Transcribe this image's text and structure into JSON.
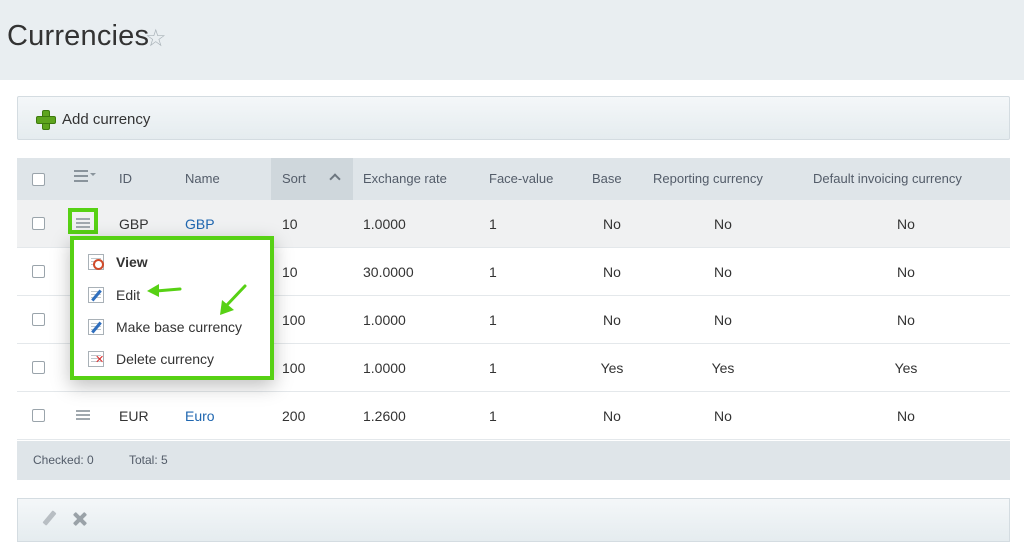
{
  "page": {
    "title": "Currencies",
    "star": "☆"
  },
  "toolbar": {
    "add_label": "Add currency"
  },
  "grid": {
    "columns": {
      "id": "ID",
      "name": "Name",
      "sort": "Sort",
      "exchange_rate": "Exchange rate",
      "face_value": "Face-value",
      "base": "Base",
      "reporting": "Reporting currency",
      "default_invoicing": "Default invoicing currency"
    },
    "rows": [
      {
        "id": "GBP",
        "name": "GBP",
        "sort": "10",
        "rate": "1.0000",
        "face": "1",
        "base": "No",
        "reporting": "No",
        "invoicing": "No"
      },
      {
        "id": "",
        "name": "",
        "sort": "10",
        "rate": "30.0000",
        "face": "1",
        "base": "No",
        "reporting": "No",
        "invoicing": "No"
      },
      {
        "id": "",
        "name": "",
        "sort": "100",
        "rate": "1.0000",
        "face": "1",
        "base": "No",
        "reporting": "No",
        "invoicing": "No"
      },
      {
        "id": "",
        "name": "",
        "sort": "100",
        "rate": "1.0000",
        "face": "1",
        "base": "Yes",
        "reporting": "Yes",
        "invoicing": "Yes"
      },
      {
        "id": "EUR",
        "name": "Euro",
        "sort": "200",
        "rate": "1.2600",
        "face": "1",
        "base": "No",
        "reporting": "No",
        "invoicing": "No"
      }
    ],
    "footer": {
      "checked": "Checked: 0",
      "total": "Total: 5"
    }
  },
  "context_menu": {
    "items": [
      {
        "label": "View",
        "icon": "view-icon"
      },
      {
        "label": "Edit",
        "icon": "edit-icon"
      },
      {
        "label": "Make base currency",
        "icon": "make-base-icon"
      },
      {
        "label": "Delete currency",
        "icon": "delete-icon"
      }
    ]
  },
  "colors": {
    "highlight": "#57d114",
    "link": "#2067b0",
    "header_bg": "#dfe5e9"
  }
}
